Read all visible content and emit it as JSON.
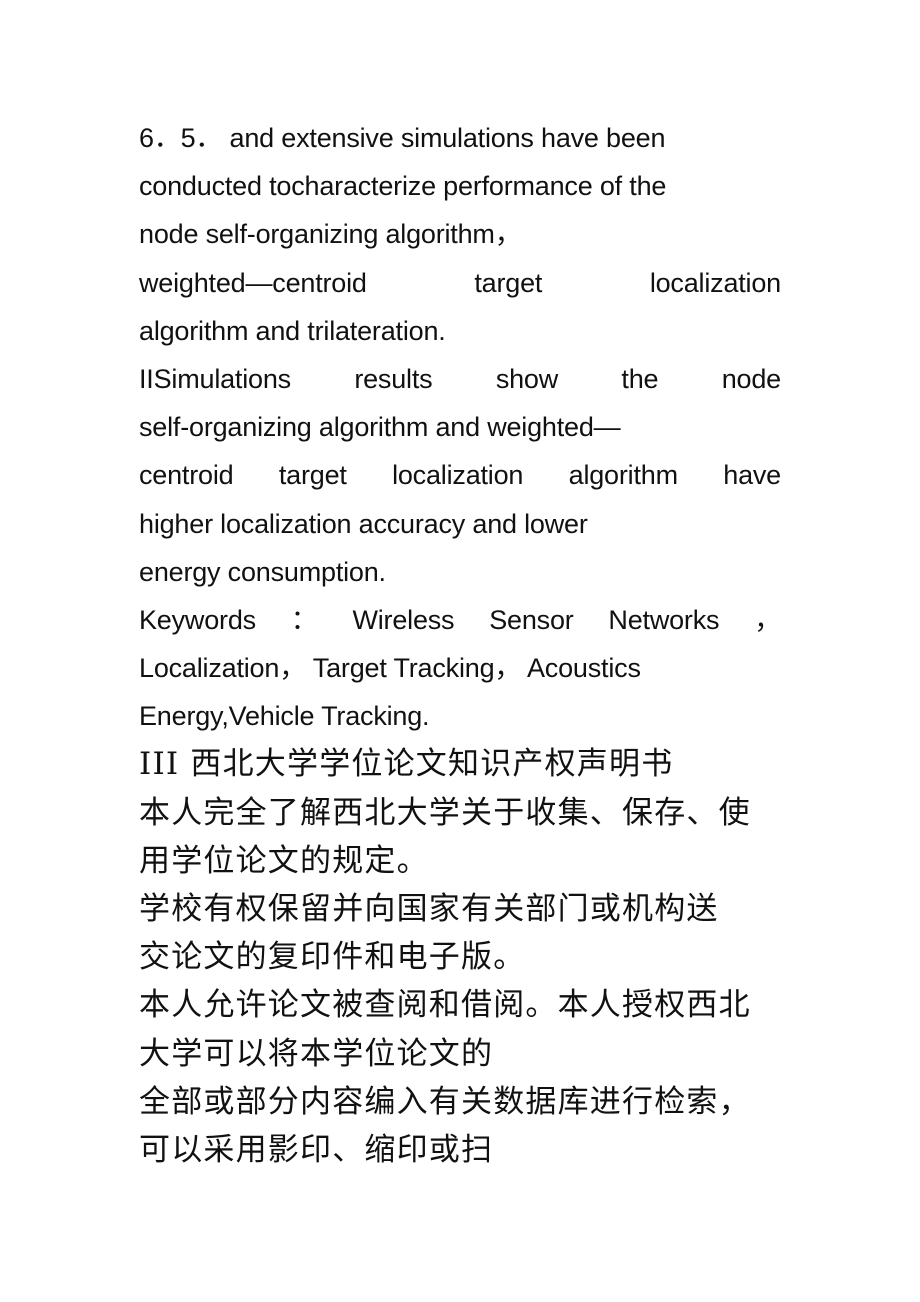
{
  "document": {
    "lines": [
      {
        "text": "6．5． and extensive simulations have been",
        "lang": "en",
        "justified": false
      },
      {
        "text": "conducted tocharacterize performance of the",
        "lang": "en",
        "justified": false
      },
      {
        "text": "node self-organizing algorithm，",
        "lang": "en",
        "justified": false
      },
      {
        "text": "weighted—centroid target localization",
        "lang": "en",
        "justified": true,
        "words": [
          "weighted—centroid",
          "target",
          "localization"
        ]
      },
      {
        "text": "algorithm and trilateration.",
        "lang": "en",
        "justified": false
      },
      {
        "text": "IISimulations results show the node",
        "lang": "en",
        "justified": true,
        "words": [
          "IISimulations",
          "results",
          "show",
          "the",
          "node"
        ]
      },
      {
        "text": "self-organizing algorithm and weighted—",
        "lang": "en",
        "justified": false
      },
      {
        "text": "centroid target localization algorithm have",
        "lang": "en",
        "justified": true,
        "words": [
          "centroid",
          "target",
          "localization",
          "algorithm",
          "have"
        ]
      },
      {
        "text": "higher localization accuracy and lower",
        "lang": "en",
        "justified": false
      },
      {
        "text": "energy consumption.",
        "lang": "en",
        "justified": false
      },
      {
        "text": "Keywords ： Wireless Sensor Networks ，",
        "lang": "en",
        "justified": true,
        "words": [
          "Keywords",
          "：",
          "Wireless",
          "Sensor",
          "Networks",
          "，"
        ]
      },
      {
        "text": "Localization， Target Tracking， Acoustics",
        "lang": "en",
        "justified": false
      },
      {
        "text": "Energy,Vehicle Tracking.",
        "lang": "en",
        "justified": false
      },
      {
        "text": "III 西北大学学位论文知识产权声明书",
        "lang": "zh",
        "justified": false
      },
      {
        "text": "本人完全了解西北大学关于收集、保存、使",
        "lang": "zh",
        "justified": false
      },
      {
        "text": "用学位论文的规定。",
        "lang": "zh",
        "justified": false
      },
      {
        "text": "学校有权保留并向国家有关部门或机构送",
        "lang": "zh",
        "justified": false
      },
      {
        "text": "交论文的复印件和电子版。",
        "lang": "zh",
        "justified": false
      },
      {
        "text": "本人允许论文被查阅和借阅。本人授权西北",
        "lang": "zh",
        "justified": false
      },
      {
        "text": "大学可以将本学位论文的",
        "lang": "zh",
        "justified": false
      },
      {
        "text": "全部或部分内容编入有关数据库进行检索，",
        "lang": "zh",
        "justified": false
      },
      {
        "text": "可以采用影印、缩印或扫",
        "lang": "zh",
        "justified": false
      }
    ]
  }
}
